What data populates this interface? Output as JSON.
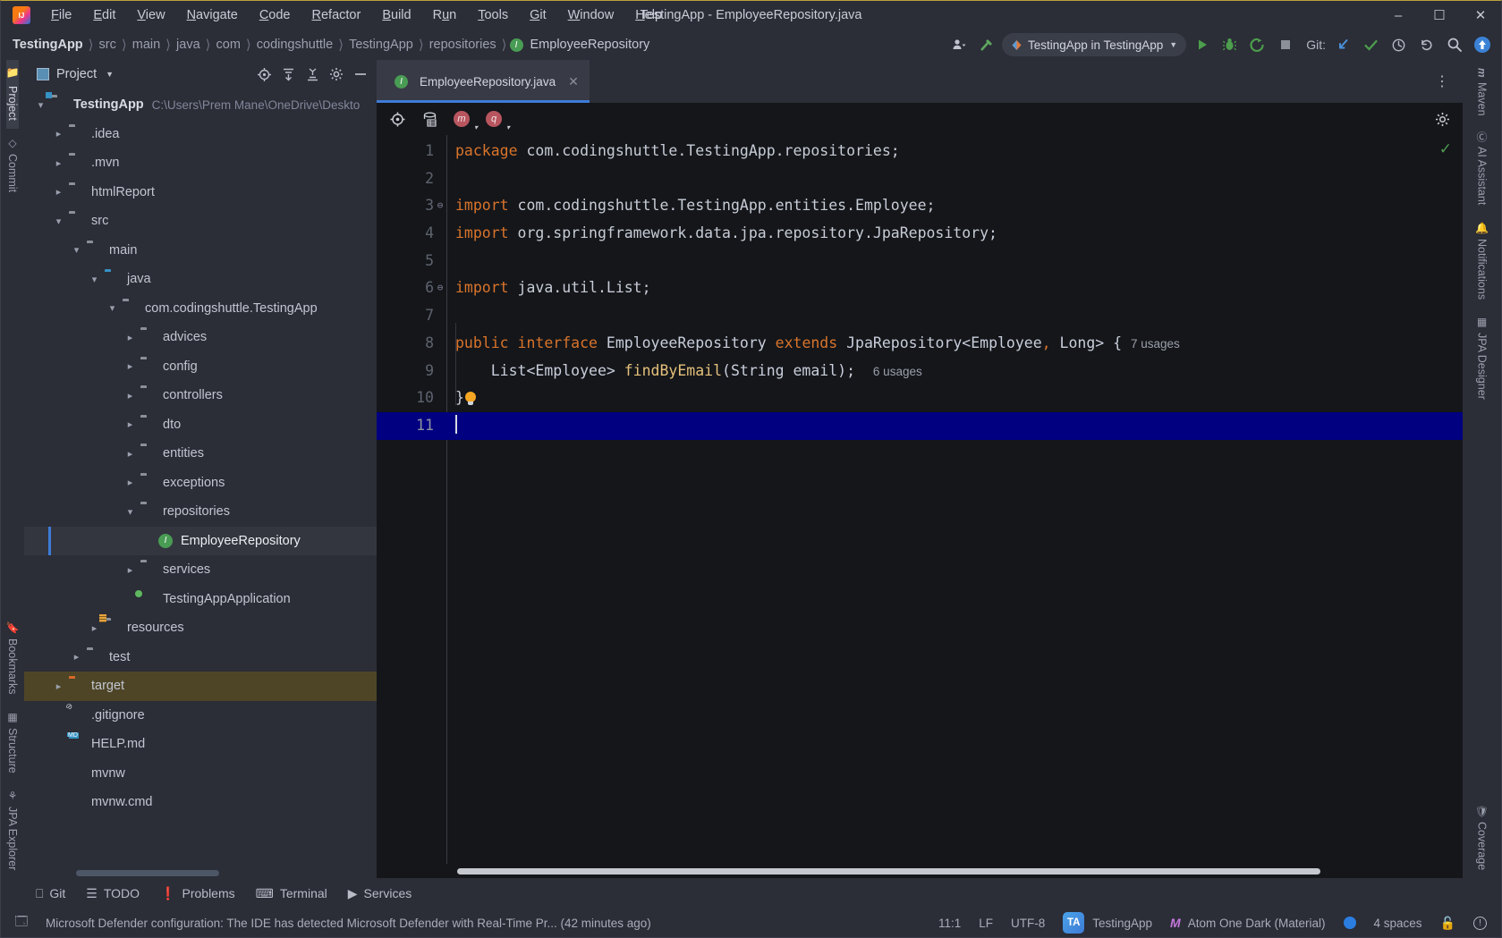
{
  "window": {
    "title": "TestingApp - EmployeeRepository.java",
    "minimize": "–",
    "maximize": "☐",
    "close": "✕"
  },
  "menu": [
    {
      "label": "File"
    },
    {
      "label": "Edit"
    },
    {
      "label": "View"
    },
    {
      "label": "Navigate"
    },
    {
      "label": "Code"
    },
    {
      "label": "Refactor"
    },
    {
      "label": "Build"
    },
    {
      "label": "Run"
    },
    {
      "label": "Tools"
    },
    {
      "label": "Git"
    },
    {
      "label": "Window"
    },
    {
      "label": "Help"
    }
  ],
  "breadcrumb": [
    {
      "label": "TestingApp"
    },
    {
      "label": "src"
    },
    {
      "label": "main"
    },
    {
      "label": "java"
    },
    {
      "label": "com"
    },
    {
      "label": "codingshuttle"
    },
    {
      "label": "TestingApp"
    },
    {
      "label": "repositories"
    },
    {
      "label": "EmployeeRepository",
      "icon": "interface-icon"
    }
  ],
  "toolbar": {
    "profile_icon": "user-profile-icon",
    "build_icon": "hammer-build-icon",
    "run_config": "TestingApp in TestingApp",
    "run_icon": "run-icon",
    "debug_icon": "debug-icon",
    "run_coverage_icon": "run-with-coverage-icon",
    "stop_icon": "stop-icon",
    "git_label": "Git:",
    "git_update_icon": "update-project-icon",
    "git_commit_icon": "commit-icon",
    "git_history_icon": "history-icon",
    "git_rollback_icon": "rollback-icon",
    "search_icon": "search-everywhere-icon",
    "updates_icon": "updates-available-icon"
  },
  "left_stripe": [
    {
      "label": "Project",
      "icon": "project-icon",
      "active": true
    },
    {
      "label": "Commit",
      "icon": "commit-icon",
      "active": false
    },
    {
      "label": "Bookmarks",
      "icon": "bookmarks-icon",
      "active": false
    },
    {
      "label": "Structure",
      "icon": "structure-icon",
      "active": false
    },
    {
      "label": "JPA Explorer",
      "icon": "jpa-explorer-icon",
      "active": false
    }
  ],
  "right_stripe": [
    {
      "label": "Maven",
      "icon": "maven-icon"
    },
    {
      "label": "AI Assistant",
      "icon": "ai-assistant-icon"
    },
    {
      "label": "Notifications",
      "icon": "notifications-icon"
    },
    {
      "label": "JPA Designer",
      "icon": "jpa-designer-icon"
    },
    {
      "label": "Coverage",
      "icon": "coverage-icon"
    }
  ],
  "project_panel": {
    "title": "Project",
    "tools": {
      "locate": "select-opened-file-icon",
      "expand": "expand-all-icon",
      "collapse": "collapse-all-icon",
      "settings": "gear-icon",
      "hide": "hide-icon"
    },
    "tree": [
      {
        "label": "TestingApp",
        "path": "C:\\Users\\Prem Mane\\OneDrive\\Deskto",
        "depth": 0,
        "arrow": "down",
        "icon": "module-folder",
        "bold": true
      },
      {
        "label": ".idea",
        "depth": 1,
        "arrow": "right",
        "icon": "folder"
      },
      {
        "label": ".mvn",
        "depth": 1,
        "arrow": "right",
        "icon": "folder"
      },
      {
        "label": "htmlReport",
        "depth": 1,
        "arrow": "right",
        "icon": "folder"
      },
      {
        "label": "src",
        "depth": 1,
        "arrow": "down",
        "icon": "folder"
      },
      {
        "label": "main",
        "depth": 2,
        "arrow": "down",
        "icon": "folder"
      },
      {
        "label": "java",
        "depth": 3,
        "arrow": "down",
        "icon": "source-folder"
      },
      {
        "label": "com.codingshuttle.TestingApp",
        "depth": 4,
        "arrow": "down",
        "icon": "package"
      },
      {
        "label": "advices",
        "depth": 5,
        "arrow": "right",
        "icon": "package"
      },
      {
        "label": "config",
        "depth": 5,
        "arrow": "right",
        "icon": "package"
      },
      {
        "label": "controllers",
        "depth": 5,
        "arrow": "right",
        "icon": "package"
      },
      {
        "label": "dto",
        "depth": 5,
        "arrow": "right",
        "icon": "package"
      },
      {
        "label": "entities",
        "depth": 5,
        "arrow": "right",
        "icon": "package"
      },
      {
        "label": "exceptions",
        "depth": 5,
        "arrow": "right",
        "icon": "package"
      },
      {
        "label": "repositories",
        "depth": 5,
        "arrow": "down",
        "icon": "package"
      },
      {
        "label": "EmployeeRepository",
        "depth": 6,
        "arrow": "none",
        "icon": "interface",
        "selected": true
      },
      {
        "label": "services",
        "depth": 5,
        "arrow": "right",
        "icon": "package"
      },
      {
        "label": "TestingAppApplication",
        "depth": 5,
        "arrow": "none",
        "icon": "spring-class"
      },
      {
        "label": "resources",
        "depth": 3,
        "arrow": "right",
        "icon": "resources-folder"
      },
      {
        "label": "test",
        "depth": 2,
        "arrow": "right",
        "icon": "folder"
      },
      {
        "label": "target",
        "depth": 1,
        "arrow": "right",
        "icon": "excluded-folder",
        "highlight": true
      },
      {
        "label": ".gitignore",
        "depth": 1,
        "arrow": "none",
        "icon": "gitignore-file"
      },
      {
        "label": "HELP.md",
        "depth": 1,
        "arrow": "none",
        "icon": "markdown-file"
      },
      {
        "label": "mvnw",
        "depth": 1,
        "arrow": "none",
        "icon": "shell-file"
      },
      {
        "label": "mvnw.cmd",
        "depth": 1,
        "arrow": "none",
        "icon": "cmd-file"
      }
    ]
  },
  "editor": {
    "tab": {
      "label": "EmployeeRepository.java",
      "icon": "interface-icon",
      "close": "✕"
    },
    "tabs_menu": "⋮",
    "tools": {
      "locate": "select-in-project-icon",
      "database": "database-icon",
      "badge_m": "m",
      "badge_q": "q",
      "settings": "gear-icon"
    },
    "inspection_status": "✓",
    "lines": [
      {
        "num": "1",
        "fold": "",
        "tokens": [
          {
            "t": "package",
            "c": "kw"
          },
          {
            "t": " com.codingshuttle.TestingApp.repositories",
            "c": "pun"
          },
          {
            "t": ";",
            "c": "pun"
          }
        ]
      },
      {
        "num": "2",
        "fold": "",
        "tokens": []
      },
      {
        "num": "3",
        "fold": "⊖",
        "tokens": [
          {
            "t": "import",
            "c": "kw"
          },
          {
            "t": " com.codingshuttle.TestingApp.entities.Employee",
            "c": "pun"
          },
          {
            "t": ";",
            "c": "pun"
          }
        ]
      },
      {
        "num": "4",
        "fold": "",
        "tokens": [
          {
            "t": "import",
            "c": "kw"
          },
          {
            "t": " org.springframework.data.jpa.repository.JpaRepository",
            "c": "pun"
          },
          {
            "t": ";",
            "c": "pun"
          }
        ]
      },
      {
        "num": "5",
        "fold": "",
        "tokens": []
      },
      {
        "num": "6",
        "fold": "⊖",
        "tokens": [
          {
            "t": "import",
            "c": "kw"
          },
          {
            "t": " java.util.List",
            "c": "pun"
          },
          {
            "t": ";",
            "c": "pun"
          }
        ]
      },
      {
        "num": "7",
        "fold": "",
        "tokens": []
      },
      {
        "num": "8",
        "fold": "",
        "tokens": [
          {
            "t": "public",
            "c": "kw"
          },
          {
            "t": " ",
            "c": "pun"
          },
          {
            "t": "interface",
            "c": "kw"
          },
          {
            "t": " EmployeeRepository ",
            "c": "cls"
          },
          {
            "t": "extends",
            "c": "kw"
          },
          {
            "t": " JpaRepository<Employee",
            "c": "cls"
          },
          {
            "t": ",",
            "c": "op"
          },
          {
            "t": " Long> { ",
            "c": "cls"
          }
        ],
        "hint": "7 usages"
      },
      {
        "num": "9",
        "fold": "",
        "tokens": [
          {
            "t": "    List<Employee> ",
            "c": "cls"
          },
          {
            "t": "findByEmail",
            "c": "mth"
          },
          {
            "t": "(String email)",
            "c": "cls"
          },
          {
            "t": ";",
            "c": "pun"
          },
          {
            "t": "  ",
            "c": "pun"
          }
        ],
        "hint": "6 usages"
      },
      {
        "num": "10",
        "fold": "",
        "tokens": [
          {
            "t": "}",
            "c": "pun"
          }
        ],
        "bulb": true
      },
      {
        "num": "11",
        "fold": "",
        "tokens": [],
        "current": true,
        "caret": true
      }
    ]
  },
  "bottom_bar": [
    {
      "label": "Git",
      "icon": "git-branch-icon"
    },
    {
      "label": "TODO",
      "icon": "todo-icon"
    },
    {
      "label": "Problems",
      "icon": "problems-icon"
    },
    {
      "label": "Terminal",
      "icon": "terminal-icon"
    },
    {
      "label": "Services",
      "icon": "services-icon"
    }
  ],
  "status_bar": {
    "message_icon": "notification-icon",
    "message": "Microsoft Defender configuration: The IDE has detected Microsoft Defender with Real-Time Pr... (42 minutes ago)",
    "caret_position": "11:1",
    "line_separator": "LF",
    "encoding": "UTF-8",
    "project_badge": "TA",
    "project_name": "TestingApp",
    "color_scheme_icon": "material-theme-icon",
    "color_scheme": "Atom One Dark (Material)",
    "indicator_icon": "blue-dot-icon",
    "indent": "4 spaces",
    "lock_icon": "unlocked-icon",
    "inspection_icon": "inspections-widget-icon"
  }
}
